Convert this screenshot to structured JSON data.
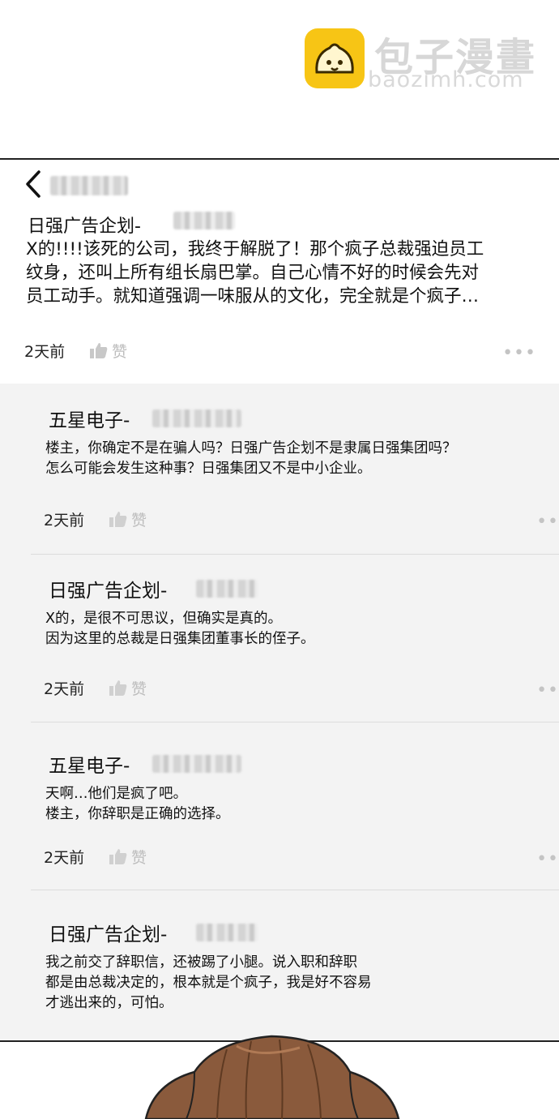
{
  "watermark": {
    "title": "包子漫畫",
    "url": "baozimh.com"
  },
  "post": {
    "author": "日强广告企划-",
    "body": "X的!!!!该死的公司，我终于解脱了！那个疯子总裁强迫员工纹身，还叫上所有组长扇巴掌。自己心情不好的时候会先对员工动手。就知道强调一味服从的文化，完全就是个疯子…",
    "time": "2天前",
    "like_label": "赞",
    "more": "•••"
  },
  "replies": [
    {
      "author": "五星电子-",
      "body": "楼主，你确定不是在骗人吗？日强广告企划不是隶属日强集团吗？\n怎么可能会发生这种事？日强集团又不是中小企业。",
      "time": "2天前",
      "like_label": "赞",
      "more": "•••"
    },
    {
      "author": "日强广告企划-",
      "body": "X的，是很不可思议，但确实是真的。\n因为这里的总裁是日强集团董事长的侄子。",
      "time": "2天前",
      "like_label": "赞",
      "more": "•••"
    },
    {
      "author": "五星电子-",
      "body": "天啊…他们是疯了吧。\n楼主，你辞职是正确的选择。",
      "time": "2天前",
      "like_label": "赞",
      "more": "•••"
    },
    {
      "author": "日强广告企划-",
      "body": "我之前交了辞职信，还被踢了小腿。说入职和辞职\n都是由总裁决定的，根本就是个疯子，我是好不容易\n才逃出来的，可怕。"
    }
  ],
  "colors": {
    "panel_bg": "#f3f3f3",
    "post_bg": "#ffffff",
    "muted": "#bdbdbd",
    "logo_yellow": "#f7c515"
  },
  "icons": [
    "back-chevron-icon",
    "thumbs-up-icon",
    "more-dots-icon",
    "bun-logo-icon"
  ]
}
